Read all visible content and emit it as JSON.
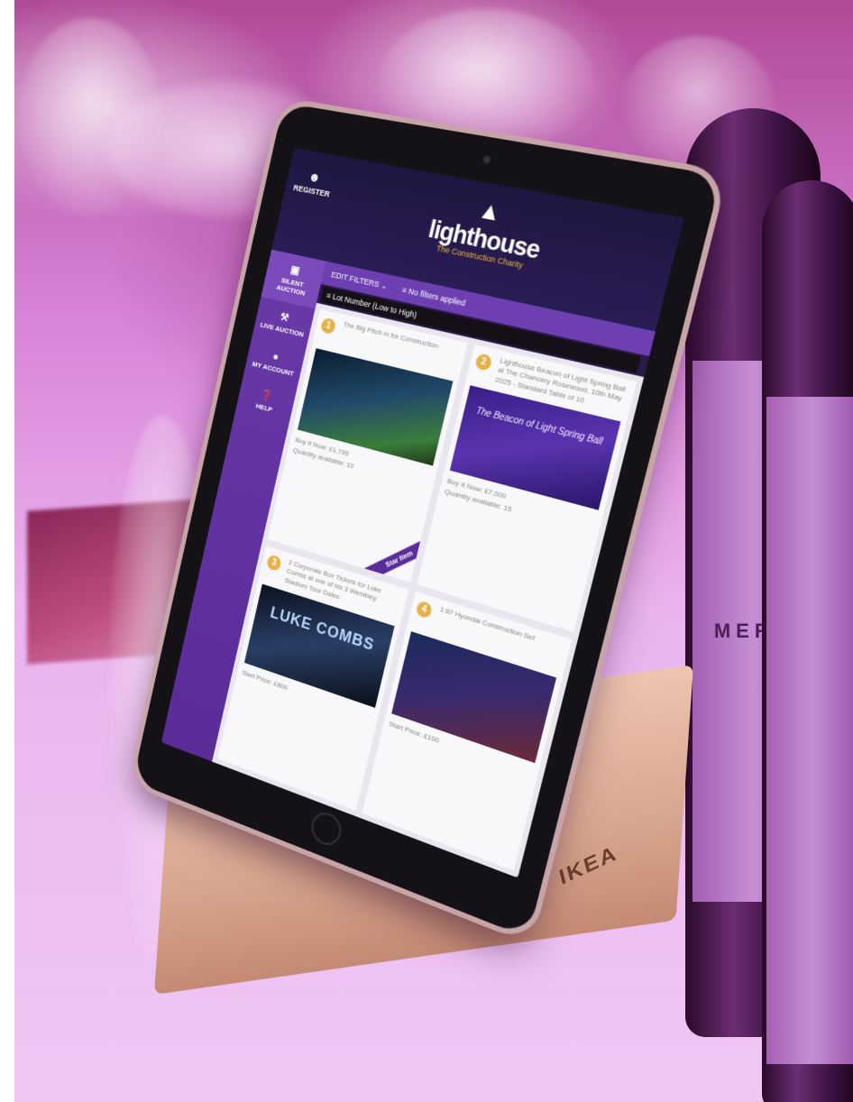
{
  "tablet_app": {
    "header": {
      "register_label": "REGISTER",
      "logo_word": "lighthouse",
      "logo_tagline": "The Construction Charity"
    },
    "sidebar": {
      "items": [
        {
          "label": "SILENT AUCTION",
          "icon": "gavel-icon"
        },
        {
          "label": "LIVE AUCTION",
          "icon": "hammer-icon"
        },
        {
          "label": "MY ACCOUNT",
          "icon": "person-icon"
        },
        {
          "label": "HELP",
          "icon": "help-icon"
        }
      ]
    },
    "filters": {
      "edit_filters": "EDIT FILTERS",
      "status": "No filters applied",
      "sort": "Lot Number (Low to High)"
    },
    "lots": [
      {
        "number": "1",
        "title": "The Big Pitch In for Construction",
        "price_line": "Buy It Now: £1,799",
        "qty_line": "Quantity available: 10",
        "ribbon": "Star Item"
      },
      {
        "number": "2",
        "title": "Lighthouse Beacon of Light Spring Ball at The Chancery Rosewood, 10th May 2025 - Standard Table of 10",
        "price_line": "Buy It Now: £7,000",
        "qty_line": "Quantity available: 15",
        "thumb_text": "The Beacon of Light Spring Ball"
      },
      {
        "number": "3",
        "title": "2 Corporate Box Tickets for Luke Combs at one of his 3 Wembley Stadium Tour Dates",
        "price_line": "Start Price: £800",
        "thumb_text": "LUKE COMBS"
      },
      {
        "number": "4",
        "title": "1:87 Hyundai Construction Set",
        "price_line": "Start Price: £100"
      }
    ]
  },
  "stand_brand": "IKEA"
}
